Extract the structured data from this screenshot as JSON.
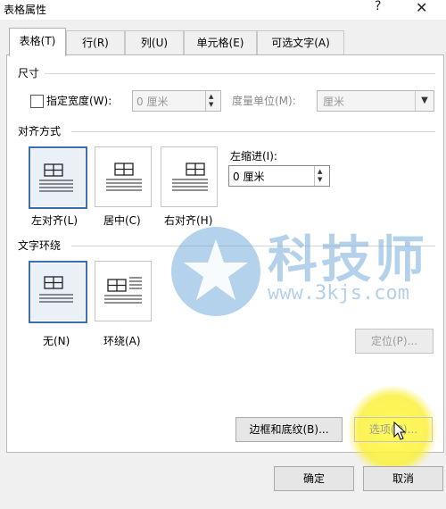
{
  "window": {
    "title": "表格属性",
    "help_glyph": "?",
    "close_glyph": "✕"
  },
  "tabs": [
    {
      "label": "表格(T)",
      "active": true
    },
    {
      "label": "行(R)",
      "active": false
    },
    {
      "label": "列(U)",
      "active": false
    },
    {
      "label": "单元格(E)",
      "active": false
    },
    {
      "label": "可选文字(A)",
      "active": false
    }
  ],
  "size": {
    "section_label": "尺寸",
    "width_checkbox_label": "指定宽度(W):",
    "width_value": "0 厘米",
    "unit_label": "度量单位(M):",
    "unit_value": "厘米"
  },
  "alignment": {
    "section_label": "对齐方式",
    "options": [
      {
        "label": "左对齐(L)",
        "selected": true
      },
      {
        "label": "居中(C)",
        "selected": false
      },
      {
        "label": "右对齐(H)",
        "selected": false
      }
    ],
    "indent_label": "左缩进(I):",
    "indent_value": "0 厘米"
  },
  "wrap": {
    "section_label": "文字环绕",
    "options": [
      {
        "label": "无(N)",
        "selected": true
      },
      {
        "label": "环绕(A)",
        "selected": false
      }
    ],
    "position_button": "定位(P)..."
  },
  "bottom": {
    "borders_button": "边框和底纹(B)...",
    "options_button": "选项(O)...",
    "ok_button": "确定",
    "cancel_button": "取消"
  },
  "watermark": {
    "brand_text": "科技师",
    "url_text": "www.3kjs.com"
  },
  "colors": {
    "selection_border": "#3a6fb5",
    "watermark": "#5b9bd5",
    "cursor_highlight": "#f5ec3c"
  }
}
